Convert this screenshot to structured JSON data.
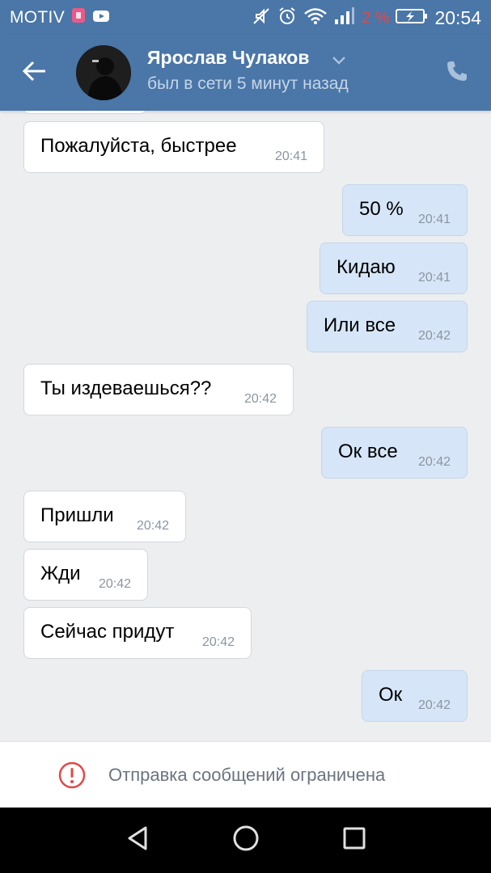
{
  "status_bar": {
    "carrier": "MOTIV",
    "battery_percent": "2 %",
    "time": "20:54",
    "icons": [
      "sim-icon",
      "youtube-icon",
      "mute-icon",
      "alarm-icon",
      "wifi-icon",
      "signal-icon",
      "battery-icon"
    ],
    "colors": {
      "background": "#4a76a8",
      "battery_percent": "#e64646"
    }
  },
  "header": {
    "contact_name": "Ярослав Чулаков",
    "contact_status": "был в сети 5 минут назад",
    "icons": [
      "back-arrow-icon",
      "chevron-down-icon",
      "phone-icon"
    ]
  },
  "messages": [
    {
      "direction": "in",
      "text": "Пожалуйста, быстрее",
      "time": "20:41"
    },
    {
      "direction": "out",
      "text": "50 %",
      "time": "20:41"
    },
    {
      "direction": "out",
      "text": "Кидаю",
      "time": "20:41"
    },
    {
      "direction": "out",
      "text": "Или все",
      "time": "20:42"
    },
    {
      "direction": "in",
      "text": "Ты издеваешься??",
      "time": "20:42"
    },
    {
      "direction": "out",
      "text": "Ок все",
      "time": "20:42"
    },
    {
      "direction": "in",
      "text": "Пришли",
      "time": "20:42"
    },
    {
      "direction": "in",
      "text": "Жди",
      "time": "20:42"
    },
    {
      "direction": "in",
      "text": "Сейчас придут",
      "time": "20:42"
    },
    {
      "direction": "out",
      "text": "Ок",
      "time": "20:42"
    }
  ],
  "restriction": {
    "text": "Отправка сообщений ограничена",
    "icon": "alert-circle-icon",
    "icon_color": "#e64646"
  },
  "navigation": {
    "icons": [
      "back-triangle-icon",
      "home-circle-icon",
      "recents-square-icon"
    ]
  }
}
